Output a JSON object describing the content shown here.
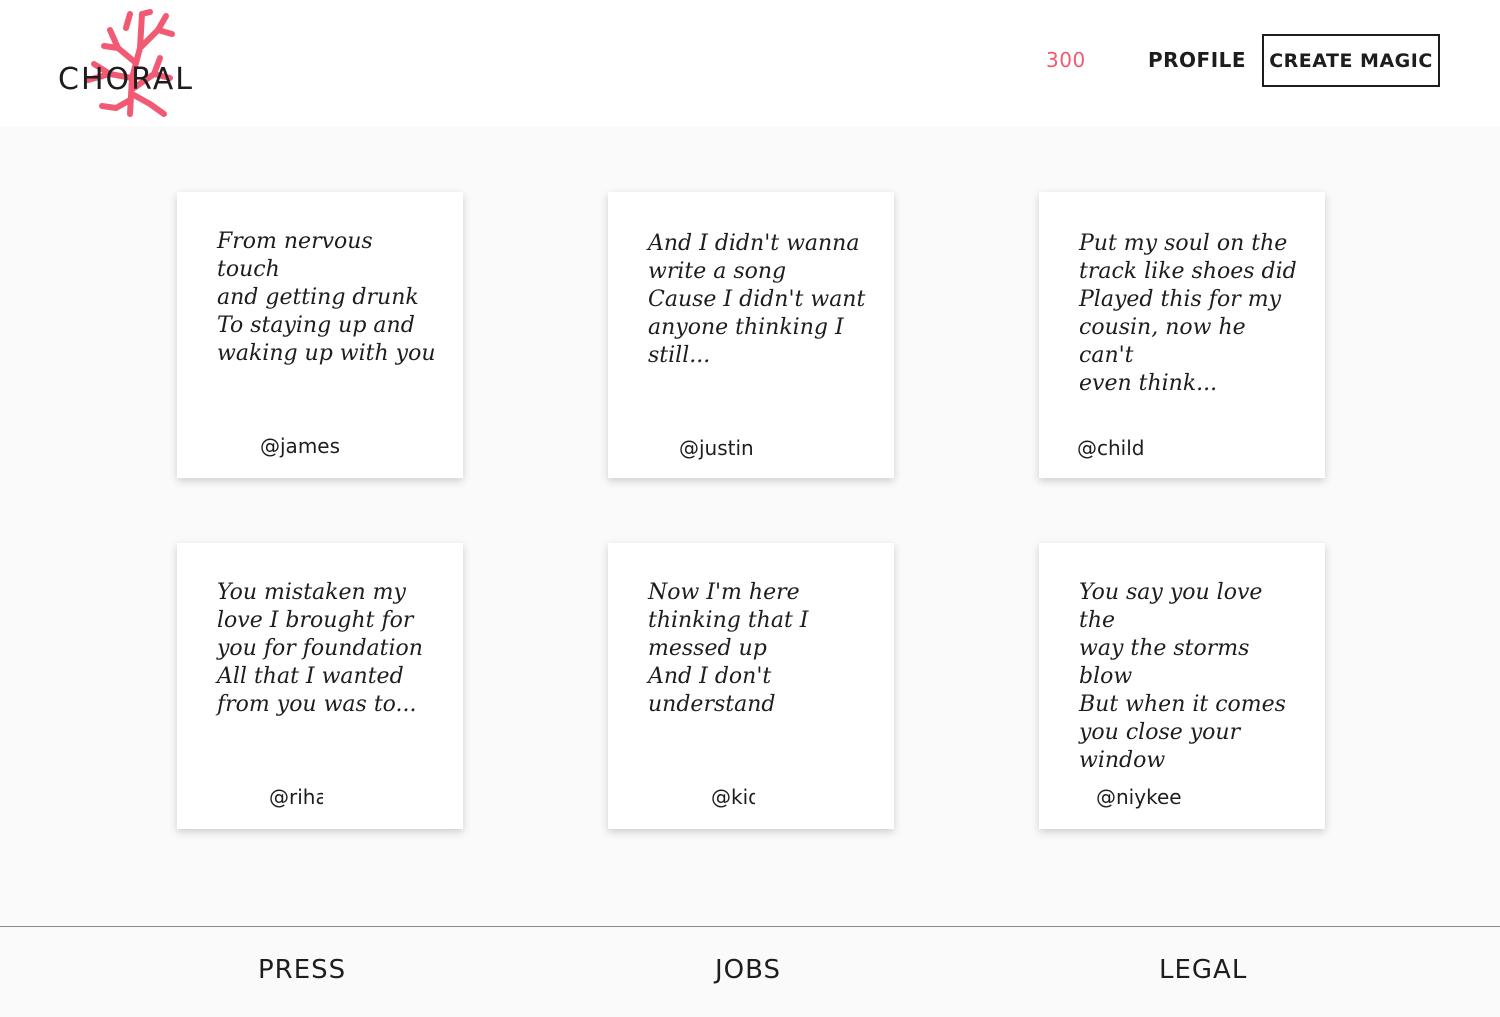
{
  "header": {
    "logo_text": "CHORAL",
    "credits": "300",
    "profile_label": "PROFILE",
    "create_label": "CREATE MAGIC"
  },
  "colors": {
    "accent": "#f25a74",
    "text": "#1d1d1d",
    "background": "#fafafa",
    "card": "#ffffff"
  },
  "cards": [
    {
      "lyric": "From nervous touch\nand getting drunk\nTo staying up and\nwaking up with you",
      "handle": "@james"
    },
    {
      "lyric": "And I didn't wanna\nwrite a song\nCause I didn't want\nanyone thinking I\nstill...",
      "handle": "@justin"
    },
    {
      "lyric": "Put my soul on the\ntrack like shoes did\nPlayed this for my\ncousin, now he can't\neven think...",
      "handle": "@child"
    },
    {
      "lyric": "You mistaken my\nlove I brought for\nyou for foundation\nAll that I wanted\nfrom you was to...",
      "handle": "@rihanna"
    },
    {
      "lyric": "Now I'm here\nthinking that I\nmessed up\nAnd I don't\nunderstand",
      "handle": "@kid"
    },
    {
      "lyric": "You say you love the\nway the storms blow\nBut when it comes\nyou close your\nwindow",
      "handle": "@niykee"
    }
  ],
  "footer": {
    "press": "PRESS",
    "jobs": "JOBS",
    "legal": "LEGAL"
  }
}
